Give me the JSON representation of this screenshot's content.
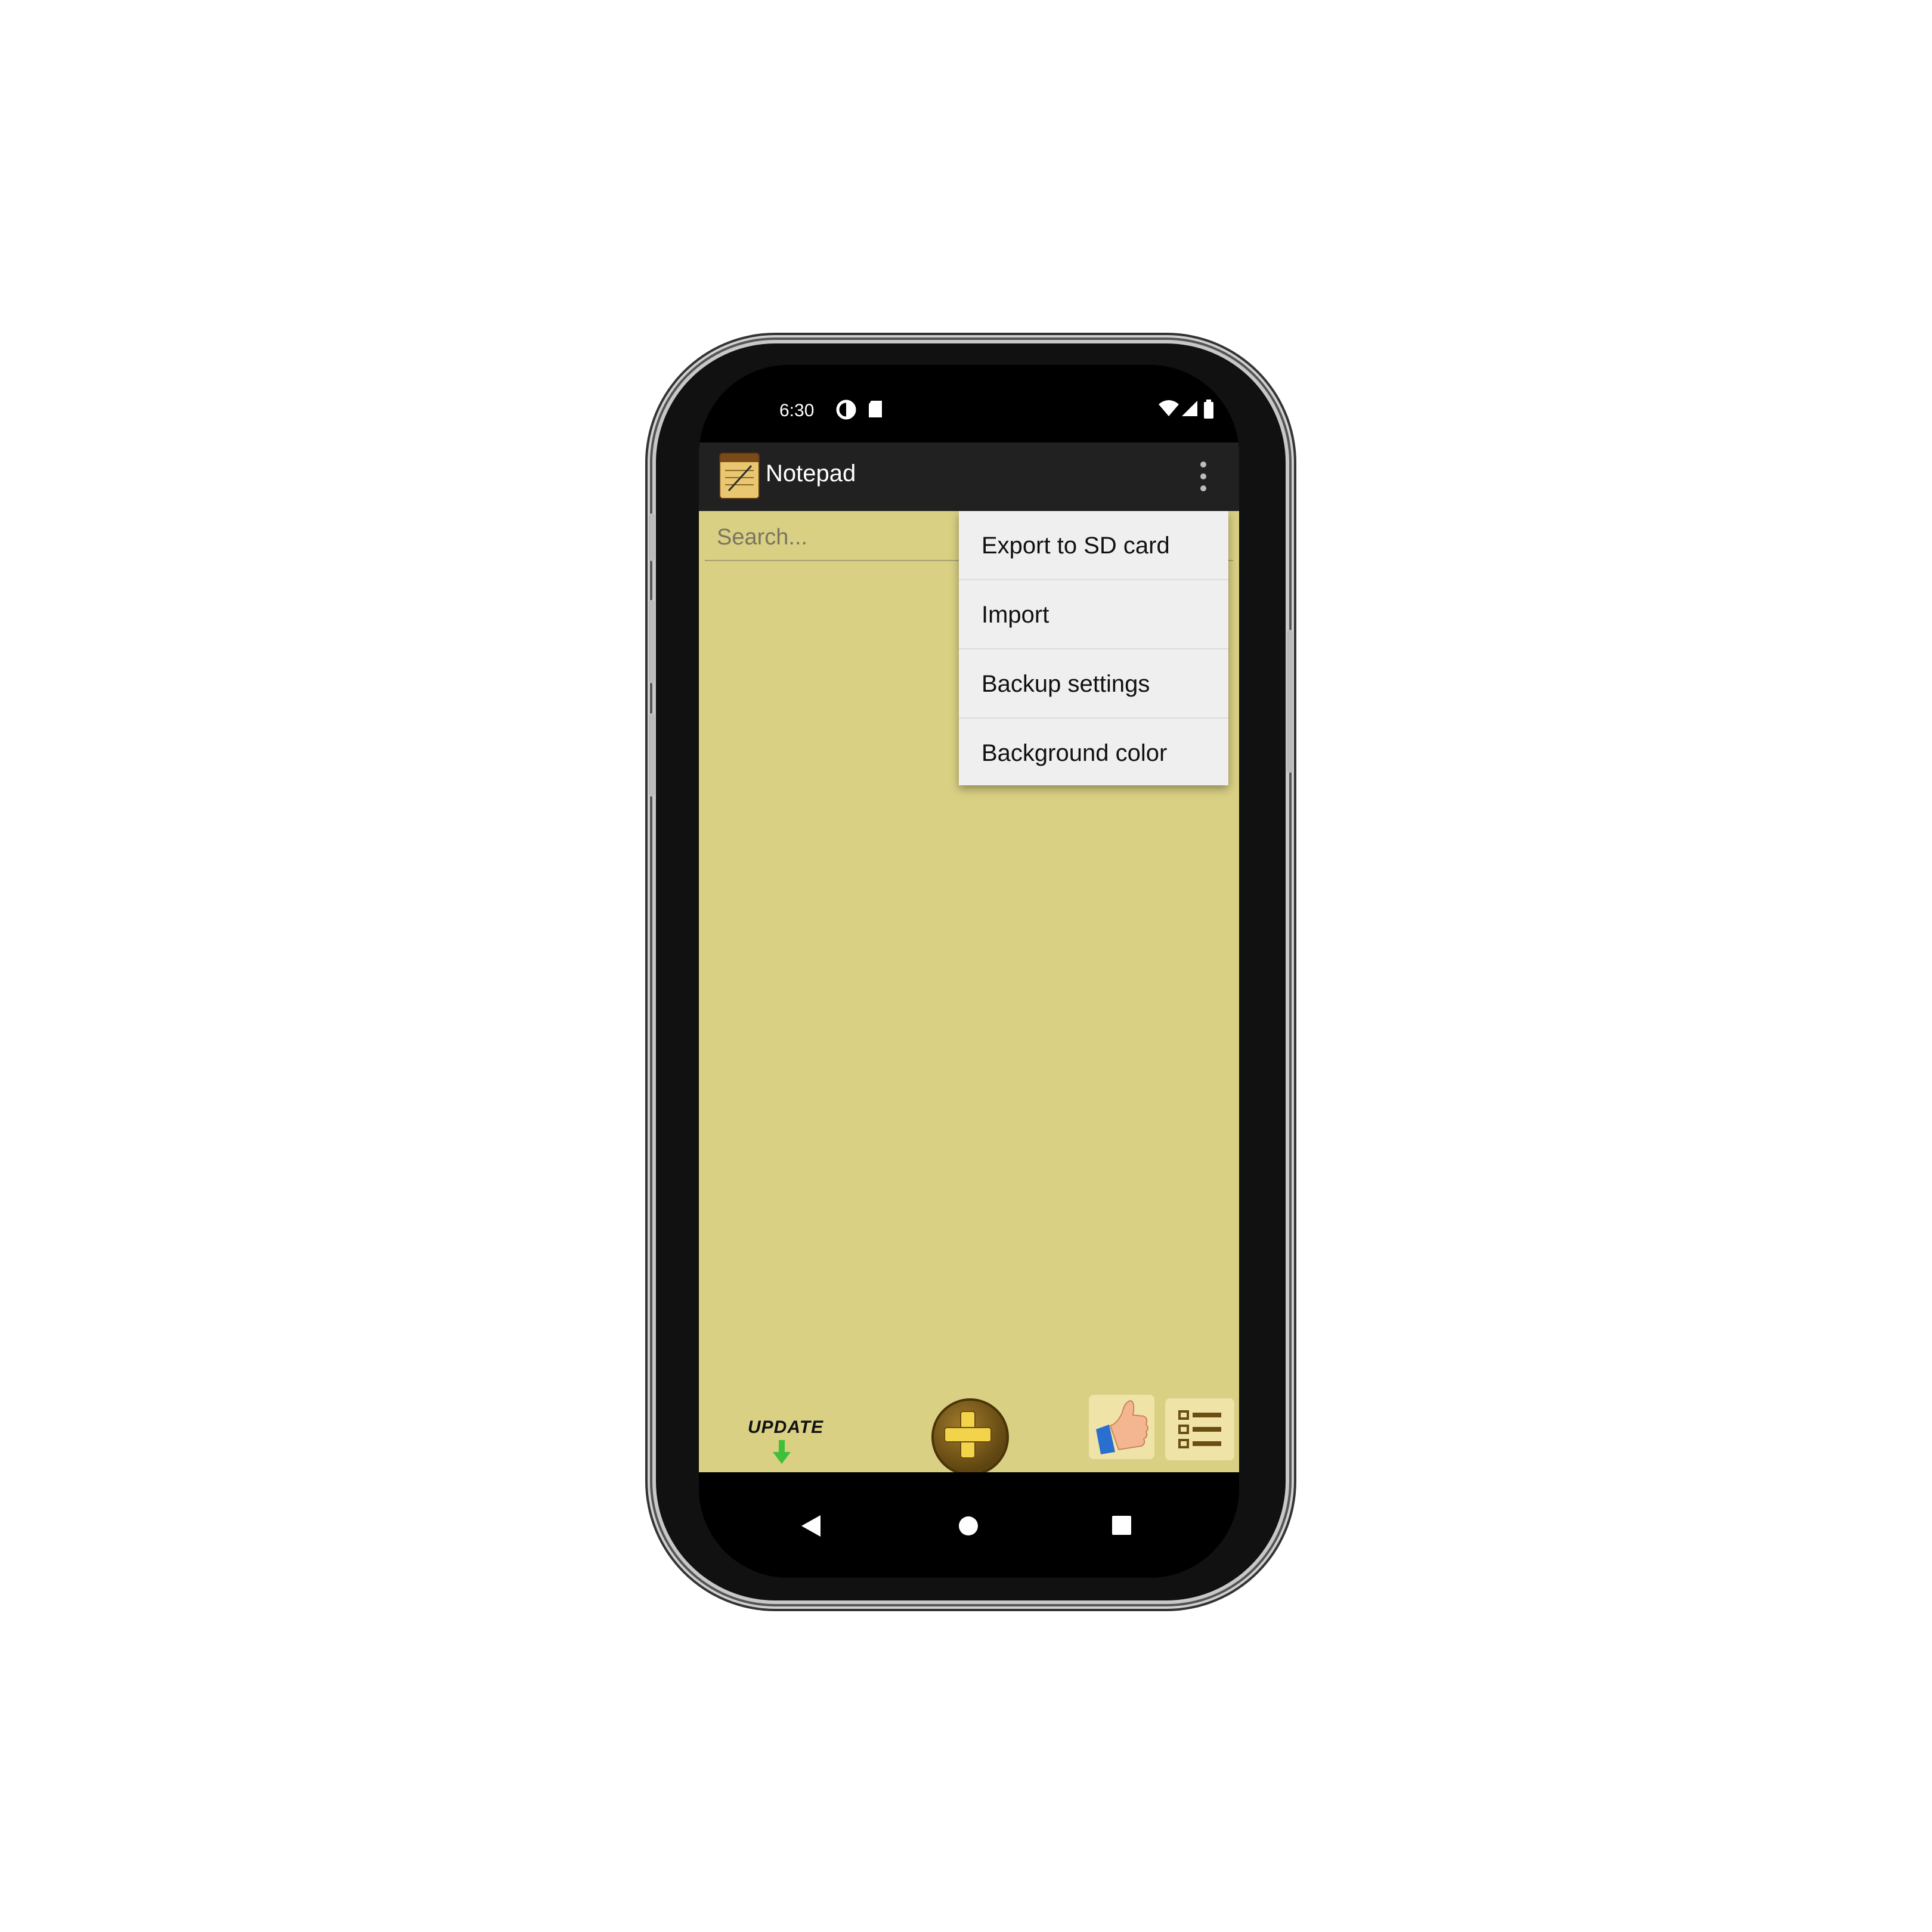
{
  "status_bar": {
    "time": "6:30",
    "icons": [
      "data-saver-icon",
      "sd-card-icon",
      "wifi-icon",
      "signal-icon",
      "battery-icon"
    ]
  },
  "app_bar": {
    "title": "Notepad",
    "icon": "notepad-app-icon",
    "overflow_icon": "more-vert-icon"
  },
  "search": {
    "placeholder": "Search..."
  },
  "overflow_menu": {
    "items": [
      {
        "label": "Export to SD card"
      },
      {
        "label": "Import"
      },
      {
        "label": "Backup settings"
      },
      {
        "label": "Background color"
      }
    ]
  },
  "bottom_bar": {
    "update_label": "UPDATE",
    "add_icon": "plus-circle-icon",
    "rate_icon": "thumbs-up-icon",
    "list_icon": "list-view-icon"
  },
  "nav_bar": {
    "icons": [
      "back-icon",
      "home-icon",
      "recents-icon"
    ]
  },
  "colors": {
    "content_bg": "#d9d083",
    "app_bar_bg": "#212121",
    "menu_bg": "#efefef",
    "accent": "#6b4d12"
  }
}
